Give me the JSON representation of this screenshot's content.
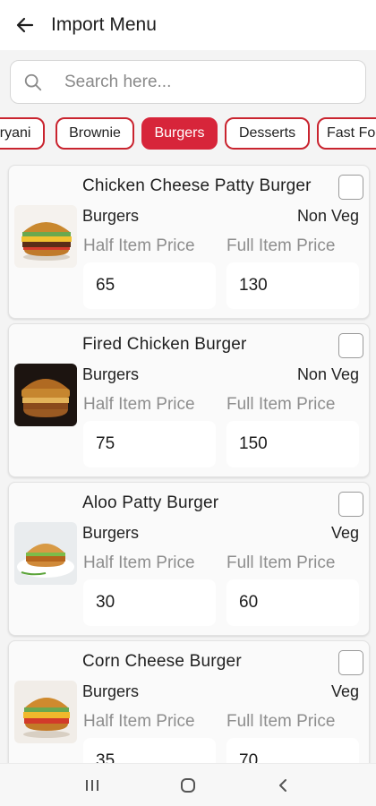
{
  "header": {
    "title": "Import Menu"
  },
  "search": {
    "placeholder": "Search here..."
  },
  "categories": [
    {
      "label": "Biryani"
    },
    {
      "label": "Brownie"
    },
    {
      "label": "Burgers",
      "active": true
    },
    {
      "label": "Desserts"
    },
    {
      "label": "Fast Food"
    }
  ],
  "price_labels": {
    "half": "Half Item Price",
    "full": "Full Item Price"
  },
  "items": [
    {
      "name": "Chicken Cheese Patty Burger",
      "category": "Burgers",
      "type": "Non Veg",
      "half_price": "65",
      "full_price": "130",
      "checked": false
    },
    {
      "name": "Fired Chicken Burger",
      "category": "Burgers",
      "type": "Non Veg",
      "half_price": "75",
      "full_price": "150",
      "checked": false
    },
    {
      "name": "Aloo Patty Burger",
      "category": "Burgers",
      "type": "Veg",
      "half_price": "30",
      "full_price": "60",
      "checked": false
    },
    {
      "name": "Corn Cheese Burger",
      "category": "Burgers",
      "type": "Veg",
      "half_price": "35",
      "full_price": "70",
      "checked": false
    }
  ],
  "colors": {
    "accent": "#d7253a",
    "chip_border": "#c9242f"
  },
  "icons": {
    "back": "arrow-left-icon",
    "search": "magnifier-icon",
    "nav": [
      "recents-icon",
      "home-icon",
      "back-chevron-icon"
    ]
  }
}
